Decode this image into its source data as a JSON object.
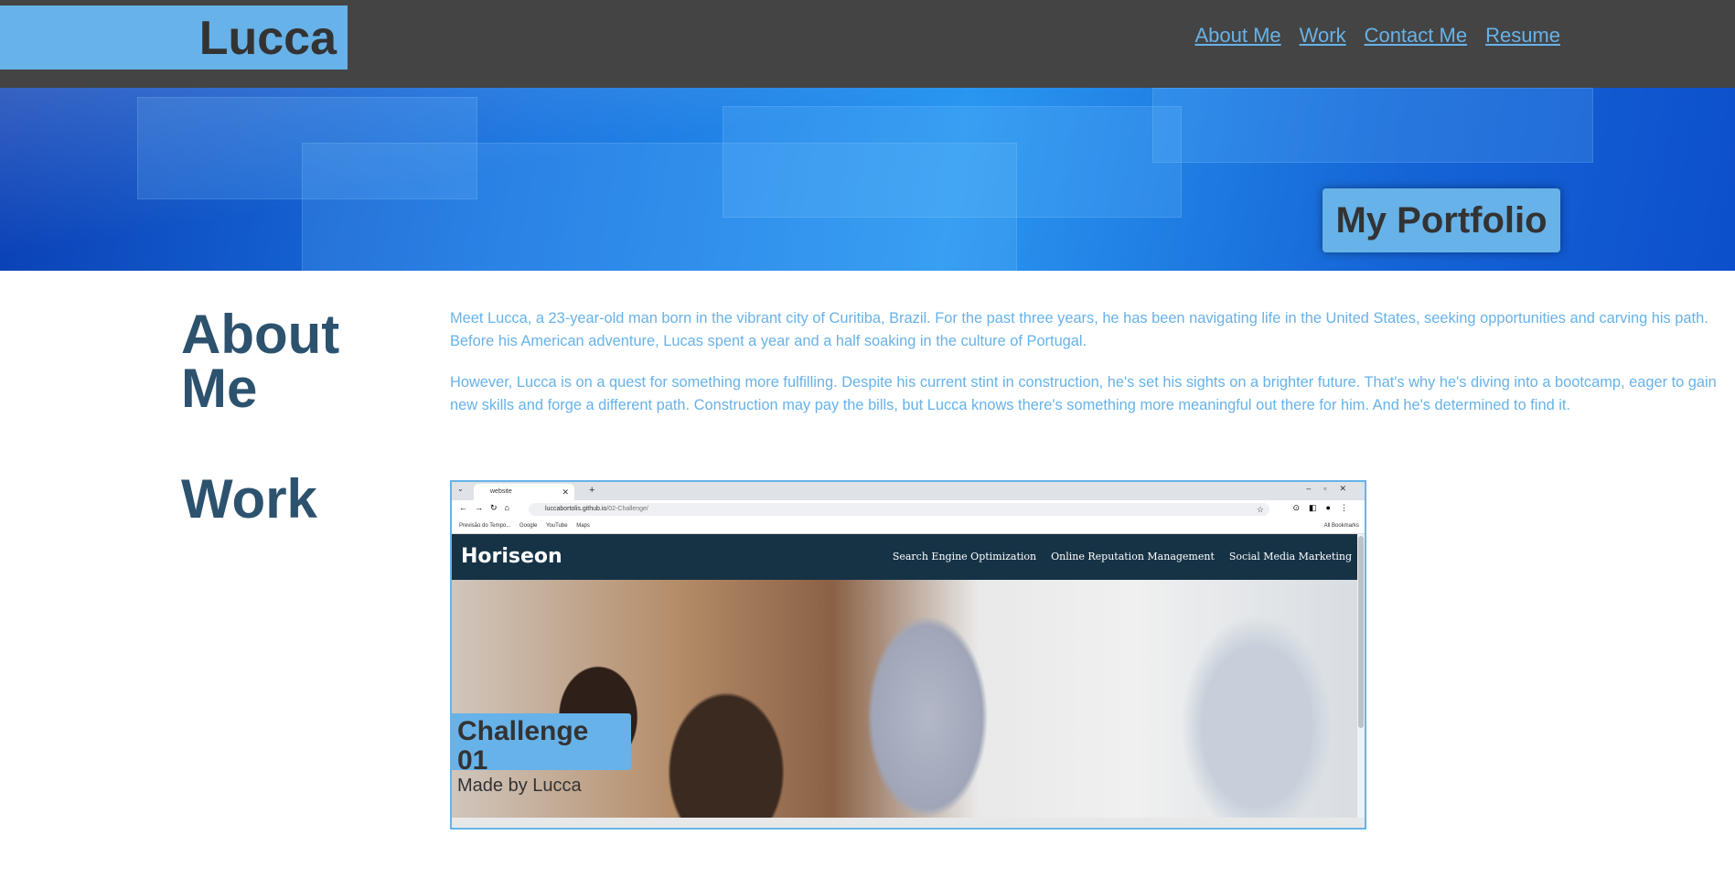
{
  "header": {
    "logo": "Lucca",
    "nav": [
      "About Me",
      "Work",
      "Contact Me",
      "Resume"
    ]
  },
  "hero": {
    "badge": "My Portfolio"
  },
  "about": {
    "title": "About Me",
    "paragraphs": [
      "Meet Lucca, a 23-year-old man born in the vibrant city of Curitiba, Brazil. For the past three years, he has been navigating life in the United States, seeking opportunities and carving his path. Before his American adventure, Lucas spent a year and a half soaking in the culture of Portugal.",
      "However, Lucca is on a quest for something more fulfilling. Despite his current stint in construction, he's set his sights on a brighter future. That's why he's diving into a bootcamp, eager to gain new skills and forge a different path. Construction may pay the bills, but Lucca knows there's something more meaningful out there for him. And he's determined to find it."
    ]
  },
  "work": {
    "title": "Work",
    "project": {
      "title": "Challenge 01",
      "subtitle": "Made by Lucca",
      "screenshot": {
        "tab_title": "website",
        "url_host": "luccabortolis.github.io",
        "url_path": "/02-Challenge/",
        "bookmarks": [
          "Previsão do Tempo...",
          "Google",
          "YouTube",
          "Maps"
        ],
        "all_bookmarks": "All Bookmarks",
        "site_logo": "Horiseon",
        "site_nav": [
          "Search Engine Optimization",
          "Online Reputation Management",
          "Social Media Marketing"
        ]
      }
    }
  },
  "colors": {
    "header_bg": "#444444",
    "accent": "#67b2e8",
    "heading": "#2c526e",
    "text_dark": "#333333"
  }
}
